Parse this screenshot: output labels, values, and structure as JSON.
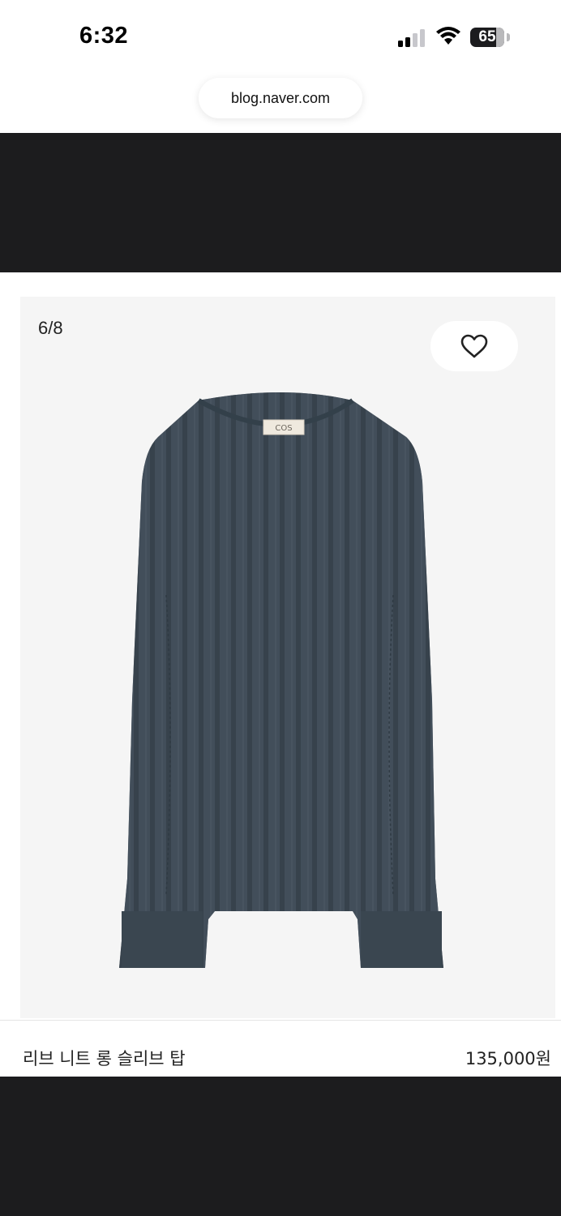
{
  "status_bar": {
    "time": "6:32",
    "battery": "65",
    "icons": [
      "cellular-signal-icon",
      "wifi-icon",
      "battery-icon"
    ]
  },
  "browser": {
    "url": "blog.naver.com"
  },
  "gallery": {
    "counter": "6/8",
    "like_icon": "heart-outline-icon",
    "label_tag": "COS"
  },
  "product": {
    "name": "리브 니트 롱 슬리브 탑",
    "price": "135,000원"
  },
  "colors": {
    "sweater": "#3e4a55",
    "dark_band": "#1c1c1e",
    "panel": "#f5f5f5"
  }
}
